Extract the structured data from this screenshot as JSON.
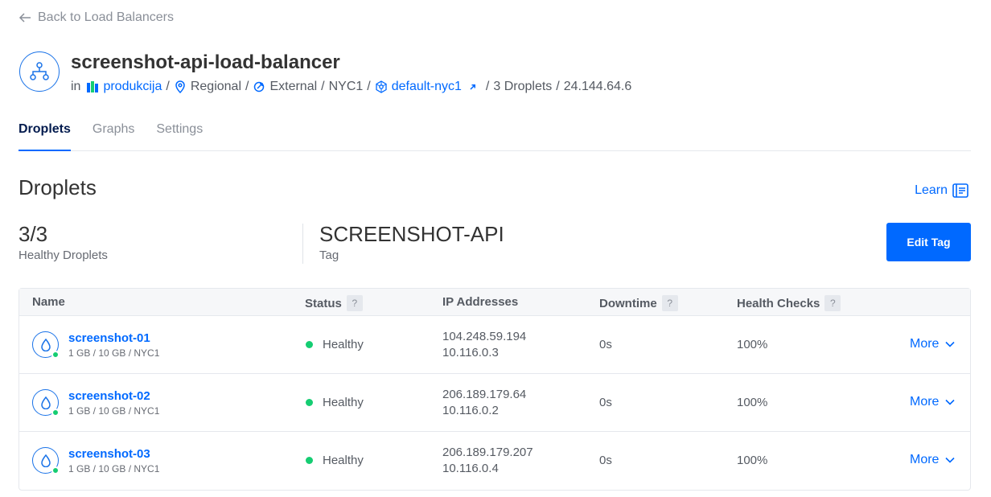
{
  "back_link": {
    "label": "Back to Load Balancers"
  },
  "header": {
    "title": "screenshot-api-load-balancer",
    "in_label": "in",
    "project": "produkcija",
    "region_type": "Regional",
    "network_type": "External",
    "datacenter": "NYC1",
    "vpc": "default-nyc1",
    "droplet_count": "3 Droplets",
    "ip": "24.144.64.6",
    "separator": "/"
  },
  "tabs": [
    {
      "label": "Droplets",
      "active": true
    },
    {
      "label": "Graphs",
      "active": false
    },
    {
      "label": "Settings",
      "active": false
    }
  ],
  "section": {
    "title": "Droplets",
    "learn_label": "Learn"
  },
  "stats": {
    "healthy_value": "3/3",
    "healthy_label": "Healthy Droplets",
    "tag_value": "SCREENSHOT-API",
    "tag_label": "Tag"
  },
  "edit_tag_label": "Edit Tag",
  "table": {
    "columns": {
      "name": "Name",
      "status": "Status",
      "ip": "IP Addresses",
      "downtime": "Downtime",
      "health": "Health Checks",
      "help": "?"
    },
    "rows": [
      {
        "name": "screenshot-01",
        "spec": "1 GB / 10 GB / NYC1",
        "status": "Healthy",
        "ip_public": "104.248.59.194",
        "ip_private": "10.116.0.3",
        "downtime": "0s",
        "health": "100%",
        "action": "More"
      },
      {
        "name": "screenshot-02",
        "spec": "1 GB / 10 GB / NYC1",
        "status": "Healthy",
        "ip_public": "206.189.179.64",
        "ip_private": "10.116.0.2",
        "downtime": "0s",
        "health": "100%",
        "action": "More"
      },
      {
        "name": "screenshot-03",
        "spec": "1 GB / 10 GB / NYC1",
        "status": "Healthy",
        "ip_public": "206.189.179.207",
        "ip_private": "10.116.0.4",
        "downtime": "0s",
        "health": "100%",
        "action": "More"
      }
    ]
  },
  "colors": {
    "accent": "#0069ff",
    "healthy": "#15cd72",
    "text": "#333333"
  }
}
